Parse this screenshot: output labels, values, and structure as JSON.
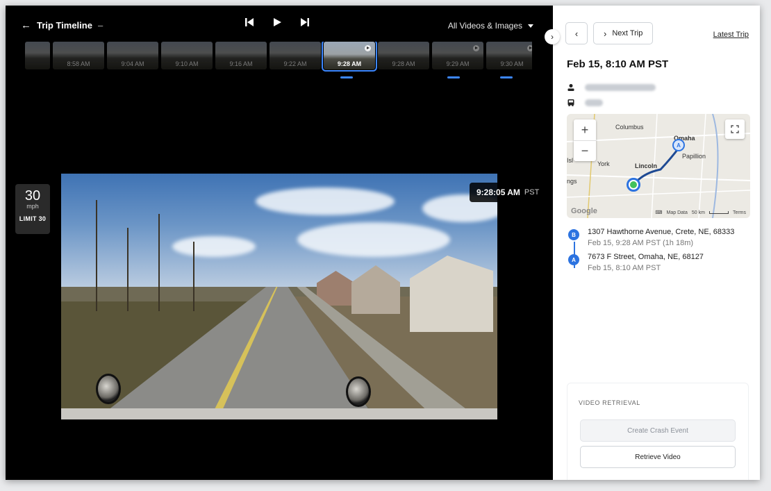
{
  "header": {
    "back_label": "Trip Timeline",
    "separator": "–",
    "filter_label": "All Videos & Images"
  },
  "timeline": {
    "thumbnails": [
      {
        "time": "8:58 AM"
      },
      {
        "time": "9:04 AM"
      },
      {
        "time": "9:10 AM"
      },
      {
        "time": "9:16 AM"
      },
      {
        "time": "9:22 AM"
      },
      {
        "time": "9:28 AM"
      },
      {
        "time": "9:28 AM"
      },
      {
        "time": "9:29 AM"
      },
      {
        "time": "9:30 AM"
      }
    ]
  },
  "overlay": {
    "speed_value": "30",
    "speed_unit": "mph",
    "speed_limit": "LIMIT 30",
    "timestamp": "9:28:05 AM",
    "timezone": "PST"
  },
  "panel": {
    "next_trip_label": "Next Trip",
    "latest_trip_label": "Latest Trip",
    "trip_title": "Feb 15, 8:10 AM PST",
    "map": {
      "labels": [
        "Columbus",
        "Omaha",
        "Papillion",
        "York",
        "Lincoln",
        "ngs",
        "Isl"
      ],
      "google": "Google",
      "map_data": "Map Data",
      "scale": "50 km",
      "terms": "Terms"
    },
    "stops": [
      {
        "pin": "B",
        "address": "1307 Hawthorne Avenue, Crete, NE, 68333",
        "when": "Feb 15, 9:28 AM PST (1h 18m)"
      },
      {
        "pin": "A",
        "address": "7673 F Street, Omaha, NE, 68127",
        "when": "Feb 15, 8:10 AM PST"
      }
    ],
    "video_retrieval": {
      "heading": "VIDEO RETRIEVAL",
      "crash_label": "Create Crash Event",
      "retrieve_label": "Retrieve Video"
    }
  },
  "colors": {
    "accent": "#3c87ff",
    "route": "#2c73e0",
    "start_marker": "#43c15b"
  }
}
